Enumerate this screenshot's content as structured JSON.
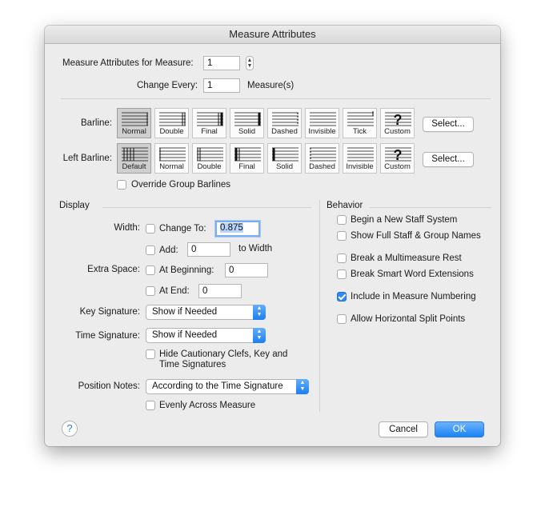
{
  "window": {
    "title": "Measure Attributes"
  },
  "header": {
    "measure_label": "Measure Attributes for Measure:",
    "measure_value": "1",
    "change_every_label": "Change Every:",
    "change_every_value": "1",
    "change_every_unit": "Measure(s)"
  },
  "barline": {
    "label": "Barline:",
    "select_label": "Select...",
    "selected": "Normal",
    "options": [
      "Normal",
      "Double",
      "Final",
      "Solid",
      "Dashed",
      "Invisible",
      "Tick",
      "Custom"
    ]
  },
  "left_barline": {
    "label": "Left Barline:",
    "select_label": "Select...",
    "selected": "Default",
    "options": [
      "Default",
      "Normal",
      "Double",
      "Final",
      "Solid",
      "Dashed",
      "Invisible",
      "Custom"
    ]
  },
  "override_group_barlines": {
    "label": "Override Group Barlines",
    "checked": false
  },
  "display": {
    "heading": "Display",
    "width_label": "Width:",
    "change_to_label": "Change To:",
    "change_to_value": "0.875",
    "add_label": "Add:",
    "add_value": "0",
    "add_suffix": "to Width",
    "extra_space_label": "Extra Space:",
    "at_beginning_label": "At Beginning:",
    "at_beginning_value": "0",
    "at_end_label": "At End:",
    "at_end_value": "0",
    "key_signature_label": "Key Signature:",
    "key_signature_value": "Show if Needed",
    "time_signature_label": "Time Signature:",
    "time_signature_value": "Show if Needed",
    "hide_cautionary_line1": "Hide Cautionary Clefs, Key and",
    "hide_cautionary_line2": "Time Signatures",
    "position_notes_label": "Position Notes:",
    "position_notes_value": "According to the Time Signature",
    "evenly_across_label": "Evenly Across Measure"
  },
  "behavior": {
    "heading": "Behavior",
    "options": [
      {
        "label": "Begin a New Staff System",
        "checked": false
      },
      {
        "label": "Show Full Staff & Group Names",
        "checked": false
      },
      {
        "label": "Break a Multimeasure Rest",
        "checked": false
      },
      {
        "label": "Break Smart Word Extensions",
        "checked": false
      },
      {
        "label": "Include in Measure Numbering",
        "checked": true
      },
      {
        "label": "Allow Horizontal Split Points",
        "checked": false
      }
    ]
  },
  "footer": {
    "help_label": "?",
    "cancel_label": "Cancel",
    "ok_label": "OK"
  },
  "colors": {
    "accent": "#1b82f5",
    "dialog_bg": "#ececec",
    "selected_tile": "#cfcfcf"
  }
}
